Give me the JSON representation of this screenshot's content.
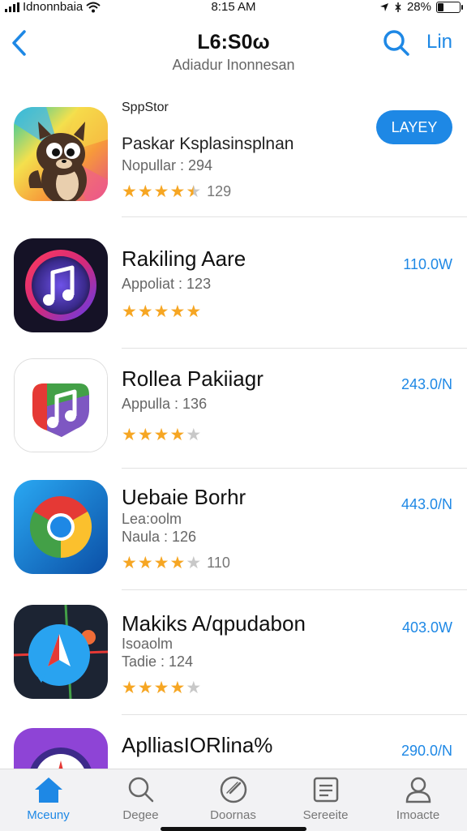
{
  "status": {
    "carrier": "Idnonnbaia",
    "time": "8:15 AM",
    "battery": "28%",
    "battery_level": 0.28
  },
  "nav": {
    "title": "L6:S0ω",
    "subtitle": "Adiadur Inonnesan",
    "link": "Lin"
  },
  "apps": [
    {
      "brand": "SppStor",
      "title": "Paskar Ksplasinsplnan",
      "sub1": "Nopullar : 294",
      "stars": 4.5,
      "count": "129",
      "button": "LAYEY"
    },
    {
      "title": "Rakiling Aare",
      "sub1": "Appoliat : 123",
      "stars": 5,
      "count": "",
      "price": "110.0W"
    },
    {
      "title": "Rollea Pakiiagr",
      "sub1": "Appulla : 136",
      "stars": 4,
      "count": "",
      "price": "243.0/N"
    },
    {
      "title": "Uebaie Borhr",
      "sub1": "Lea:oolm",
      "sub2": "Naula : 126",
      "stars": 4,
      "count": "110",
      "price": "443.0/N"
    },
    {
      "title": "Makiks A/qpudabon",
      "sub1": "Isoaolm",
      "sub2": "Tadie : 124",
      "stars": 4,
      "count": "",
      "price": "403.0W"
    },
    {
      "title": "AplliasIORlina%",
      "price": "290.0/N"
    }
  ],
  "tabs": [
    {
      "label": "Mceuny",
      "icon": "home-icon"
    },
    {
      "label": "Degee",
      "icon": "search-icon"
    },
    {
      "label": "Doornas",
      "icon": "compass-icon"
    },
    {
      "label": "Sereeite",
      "icon": "list-icon"
    },
    {
      "label": "Imoacte",
      "icon": "person-icon"
    }
  ],
  "colors": {
    "accent": "#1e88e5",
    "star": "#f6a623",
    "star_empty": "#c8c8c8"
  }
}
